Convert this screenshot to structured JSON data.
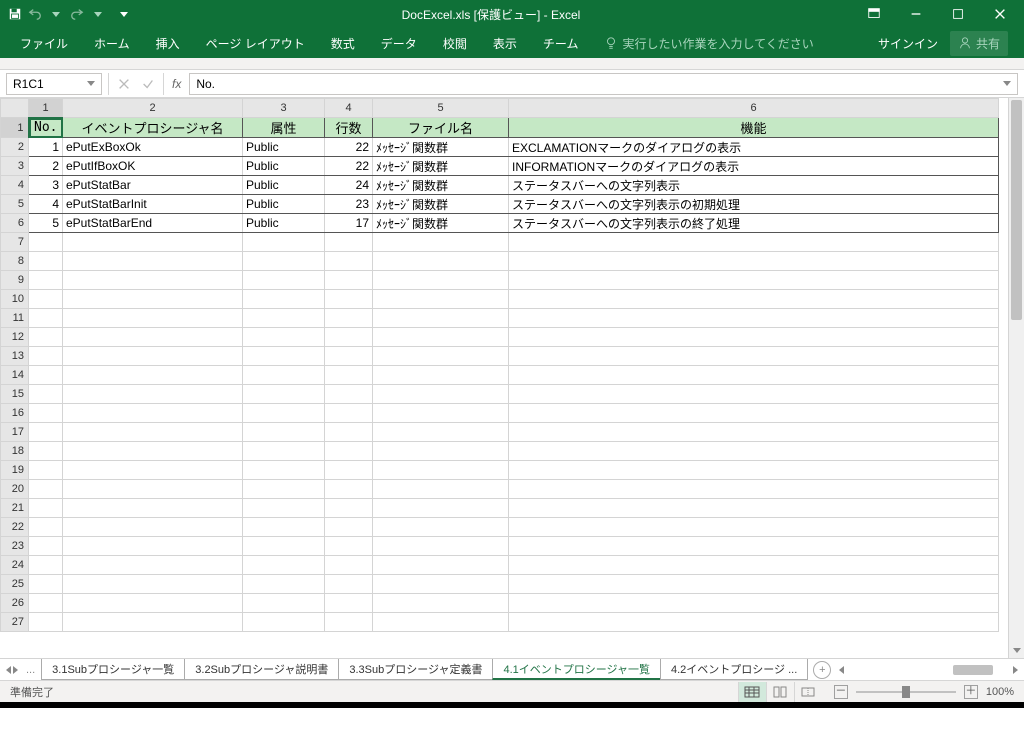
{
  "title": "DocExcel.xls  [保護ビュー] - Excel",
  "ribbon": {
    "file": "ファイル",
    "home": "ホーム",
    "insert": "挿入",
    "layout": "ページ レイアウト",
    "formulas": "数式",
    "data": "データ",
    "review": "校閲",
    "view": "表示",
    "team": "チーム",
    "tellme": "実行したい作業を入力してください",
    "signin": "サインイン",
    "share": "共有"
  },
  "namebox": "R1C1",
  "fx": "fx",
  "formula": "No.",
  "col_headers": [
    "1",
    "2",
    "3",
    "4",
    "5",
    "6"
  ],
  "row_headers": [
    "1",
    "2",
    "3",
    "4",
    "5",
    "6",
    "7",
    "8",
    "9",
    "10",
    "11",
    "12",
    "13",
    "14",
    "15",
    "16",
    "17",
    "18",
    "19",
    "20",
    "21",
    "22",
    "23",
    "24",
    "25",
    "26",
    "27"
  ],
  "table": {
    "headers": {
      "no": "No.",
      "proc": "イベントプロシージャ名",
      "attr": "属性",
      "lines": "行数",
      "file": "ファイル名",
      "func": "機能"
    },
    "rows": [
      {
        "no": "1",
        "proc": "ePutExBoxOk",
        "attr": "Public",
        "lines": "22",
        "file": "ﾒｯｾｰｼﾞ関数群",
        "func": "EXCLAMATIONマークのダイアログの表示"
      },
      {
        "no": "2",
        "proc": "ePutIfBoxOK",
        "attr": "Public",
        "lines": "22",
        "file": "ﾒｯｾｰｼﾞ関数群",
        "func": "INFORMATIONマークのダイアログの表示"
      },
      {
        "no": "3",
        "proc": "ePutStatBar",
        "attr": "Public",
        "lines": "24",
        "file": "ﾒｯｾｰｼﾞ関数群",
        "func": "ステータスバーへの文字列表示"
      },
      {
        "no": "4",
        "proc": "ePutStatBarInit",
        "attr": "Public",
        "lines": "23",
        "file": "ﾒｯｾｰｼﾞ関数群",
        "func": "ステータスバーへの文字列表示の初期処理"
      },
      {
        "no": "5",
        "proc": "ePutStatBarEnd",
        "attr": "Public",
        "lines": "17",
        "file": "ﾒｯｾｰｼﾞ関数群",
        "func": "ステータスバーへの文字列表示の終了処理"
      }
    ]
  },
  "sheets": {
    "ellipsis": "...",
    "s1": "3.1Subプロシージャ一覧",
    "s2": "3.2Subプロシージャ説明書",
    "s3": "3.3Subプロシージャ定義書",
    "s4": "4.1イベントプロシージャ一覧",
    "s5": "4.2イベントプロシージ ..."
  },
  "status": {
    "ready": "準備完了",
    "zoom": "100%"
  },
  "icons": {
    "plus": "＋",
    "minus": "－"
  }
}
